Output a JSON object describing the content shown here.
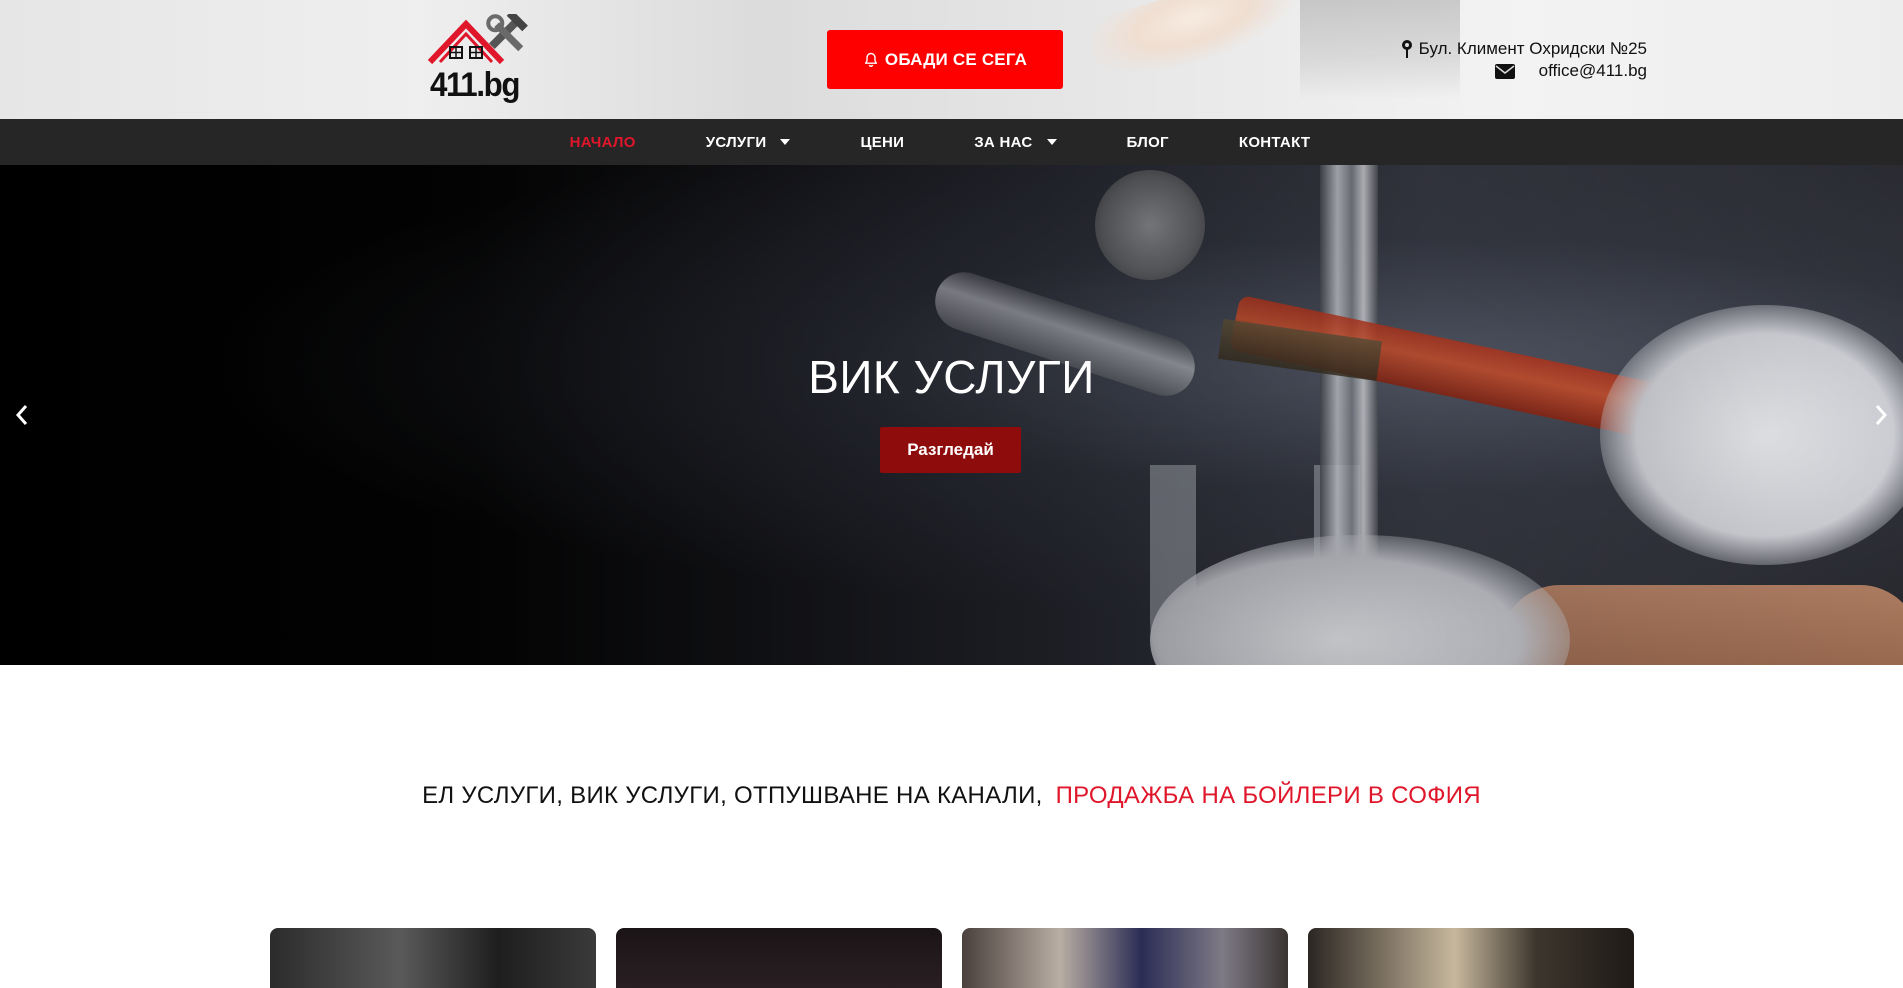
{
  "header": {
    "logo_text": "411.bg",
    "call_button_label": "ОБАДИ СЕ СЕГА",
    "address": "Бул. Климент Охридски №25",
    "email": "office@411.bg"
  },
  "nav": {
    "items": [
      {
        "label": "НАЧАЛО",
        "active": true,
        "has_dropdown": false
      },
      {
        "label": "УСЛУГИ",
        "active": false,
        "has_dropdown": true
      },
      {
        "label": "ЦЕНИ",
        "active": false,
        "has_dropdown": false
      },
      {
        "label": "ЗА НАС",
        "active": false,
        "has_dropdown": true
      },
      {
        "label": "БЛОГ",
        "active": false,
        "has_dropdown": false
      },
      {
        "label": "КОНТАКТ",
        "active": false,
        "has_dropdown": false
      }
    ]
  },
  "hero": {
    "title": "ВИК УСЛУГИ",
    "button_label": "Разгледай"
  },
  "tagline": {
    "main": "ЕЛ УСЛУГИ, ВИК УСЛУГИ, ОТПУШВАНЕ НА КАНАЛИ,",
    "highlight": "ПРОДАЖБА НА БОЙЛЕРИ В СОФИЯ"
  },
  "colors": {
    "accent": "#ff0000",
    "nav_active": "#e0162b",
    "nav_bg": "#262626",
    "hero_button": "#8e0c0c"
  },
  "icons": {
    "call": "bell-icon",
    "address": "map-pin-icon",
    "email": "envelope-icon",
    "prev": "chevron-left-icon",
    "next": "chevron-right-icon"
  }
}
